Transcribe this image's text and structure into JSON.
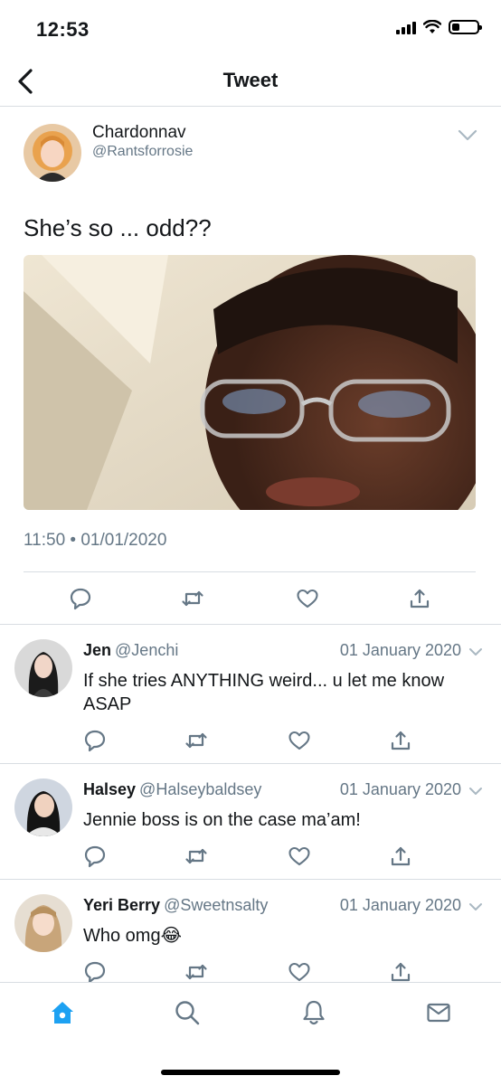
{
  "status_bar": {
    "time": "12:53"
  },
  "header": {
    "title": "Tweet"
  },
  "tweet": {
    "author_name": "Chardonnav",
    "author_handle": "@Rantsforrosie",
    "text": "She’s so ... odd??",
    "meta": "11:50 • 01/01/2020"
  },
  "replies": [
    {
      "name": "Jen",
      "handle": "@Jenchi",
      "date": "01 January 2020",
      "text": "If she tries ANYTHING weird... u let me know ASAP"
    },
    {
      "name": "Halsey",
      "handle": "@Halseybaldsey",
      "date": "01 January 2020",
      "text": "Jennie boss is on the case ma’am!"
    },
    {
      "name": "Yeri Berry",
      "handle": "@Sweetnsalty",
      "date": "01 January 2020",
      "text": "Who omg😂"
    }
  ],
  "icons": {
    "back": "back-chevron-icon",
    "more": "chevron-down-icon",
    "reply": "reply-icon",
    "retweet": "retweet-icon",
    "like": "heart-icon",
    "share": "share-icon",
    "home": "home-icon",
    "search": "search-icon",
    "notifications": "bell-icon",
    "messages": "mail-icon"
  },
  "colors": {
    "accent": "#1da1f2",
    "icon_gray": "#657786",
    "divider": "#d8dde2"
  }
}
